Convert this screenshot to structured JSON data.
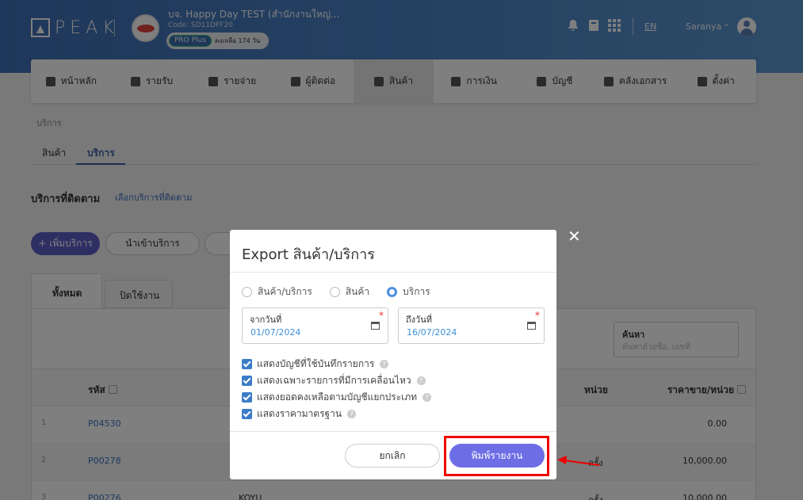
{
  "header": {
    "logo_text": "PEAK",
    "company_name": "บจ. Happy Day TEST (สำนักงานใหญ่...",
    "company_code": "Code: SD11DFF20",
    "plan_badge": "PRO Plus",
    "plan_remaining": "คงเหลือ 174 วัน",
    "language": "EN",
    "user_name": "Saranya"
  },
  "nav": {
    "items": [
      {
        "label": "หน้าหลัก",
        "icon": "gauge-icon"
      },
      {
        "label": "รายรับ",
        "icon": "list-icon"
      },
      {
        "label": "รายจ่าย",
        "icon": "list-icon"
      },
      {
        "label": "ผู้ติดต่อ",
        "icon": "contact-icon"
      },
      {
        "label": "สินค้า",
        "icon": "cube-icon",
        "active": true
      },
      {
        "label": "การเงิน",
        "icon": "money-icon"
      },
      {
        "label": "บัญชี",
        "icon": "ledger-icon"
      },
      {
        "label": "คลังเอกสาร",
        "icon": "folder-icon"
      },
      {
        "label": "ตั้งค่า",
        "icon": "gear-icon"
      }
    ]
  },
  "page": {
    "breadcrumb": "บริการ",
    "subtabs": [
      "สินค้า",
      "บริการ"
    ],
    "follow_title": "บริการที่ติดตาม",
    "follow_link": "เลือกบริการที่ติดตาม",
    "add_button": "+ เพิ่มบริการ",
    "import_button": "นำเข้าบริการ",
    "tabs": [
      "ทั้งหมด",
      "ปิดใช้งาน"
    ],
    "search_label": "ค้นหา",
    "search_placeholder": "ค้นหาด้วยชื่อ, เลขที่"
  },
  "table": {
    "headers": {
      "code": "รหัส",
      "unit": "หน่วย",
      "price": "ราคาขาย/หน่วย"
    },
    "rows": [
      {
        "idx": "1",
        "code": "P04530",
        "name": "",
        "unit": "",
        "price": "0.00"
      },
      {
        "idx": "2",
        "code": "P00278",
        "name": "",
        "unit": "ครั้ง",
        "price": "10,000.00"
      },
      {
        "idx": "3",
        "code": "P00276",
        "name": "KOYU",
        "unit": "ครั้ง",
        "price": "10,000.00"
      }
    ]
  },
  "modal": {
    "title": "Export สินค้า/บริการ",
    "radios": [
      {
        "label": "สินค้า/บริการ",
        "checked": false
      },
      {
        "label": "สินค้า",
        "checked": false
      },
      {
        "label": "บริการ",
        "checked": true
      }
    ],
    "from_date_label": "จากวันที่",
    "from_date_value": "01/07/2024",
    "to_date_label": "ถึงวันที่",
    "to_date_value": "16/07/2024",
    "required_mark": "*",
    "checkboxes": [
      "แสดงบัญชีที่ใช้บันทึกรายการ",
      "แสดงเฉพาะรายการที่มีการเคลื่อนไหว",
      "แสดงยอดคงเหลือตามบัญชีแยกประเภท",
      "แสดงราคามาตรฐาน"
    ],
    "help_glyph": "?",
    "cancel_button": "ยกเลิก",
    "print_button": "พิมพ์รายงาน",
    "close_glyph": "✕"
  },
  "colors": {
    "primary": "#6d6ee6",
    "link": "#3b6fc0",
    "highlight": "#e00000"
  }
}
